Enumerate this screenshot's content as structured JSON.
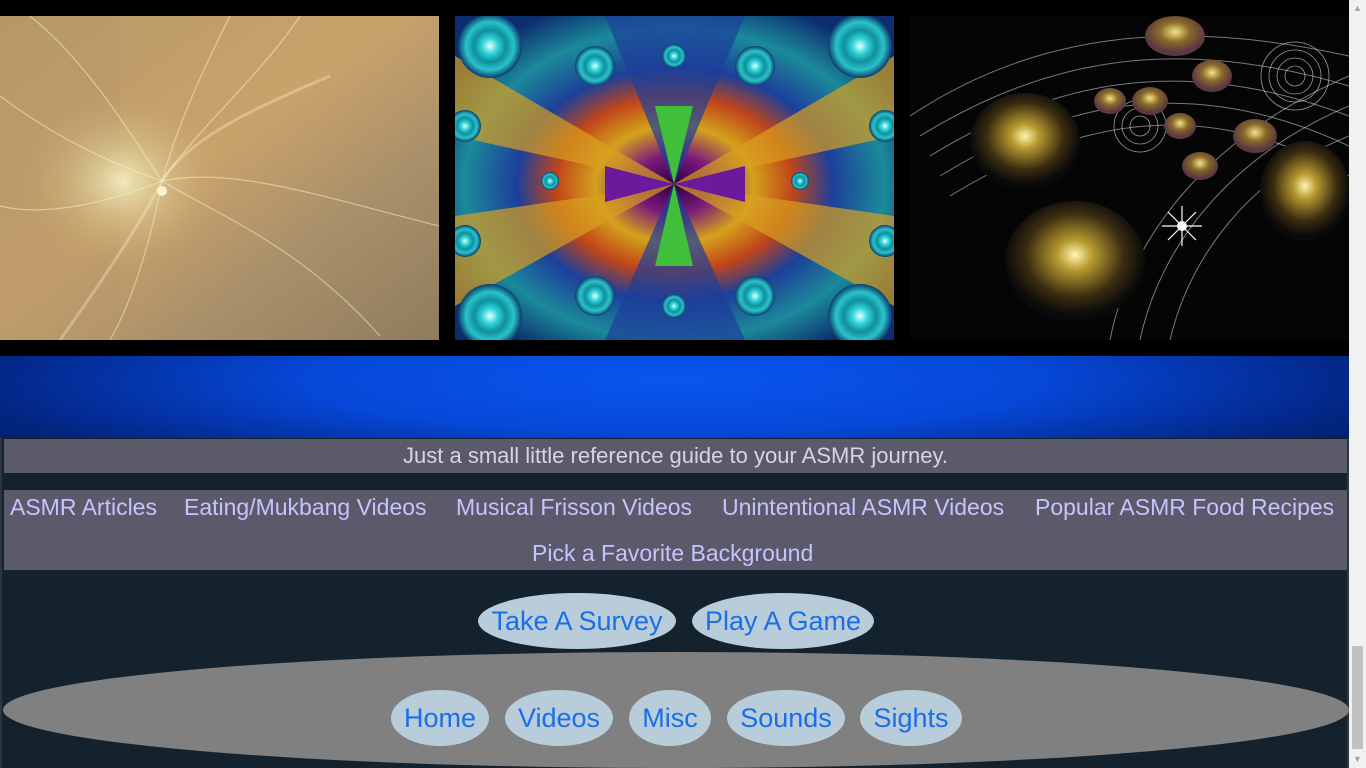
{
  "gallery": {
    "images": [
      {
        "name": "golden-fractal-image"
      },
      {
        "name": "psychedelic-fractal-image"
      },
      {
        "name": "spiral-orbs-fractal-image"
      }
    ]
  },
  "footer": {
    "tagline": "Just a small little reference guide to your ASMR journey.",
    "links": [
      "ASMR Articles",
      "Eating/Mukbang Videos",
      "Musical Frisson Videos",
      "Unintentional ASMR Videos",
      "Popular ASMR Food Recipes",
      "Pick a Favorite Background"
    ],
    "actions": {
      "survey": "Take A Survey",
      "game": "Play A Game"
    },
    "nav": {
      "home": "Home",
      "videos": "Videos",
      "misc": "Misc",
      "sounds": "Sounds",
      "sights": "Sights"
    }
  },
  "colors": {
    "pill_bg": "#b8cdd9",
    "pill_text": "#1a6fe8",
    "link_text": "#c8c2ff",
    "band_blue": "#0648d8",
    "footer_bg": "#14222e",
    "bar_bg": "#5b5a6b"
  },
  "scrollbar": {
    "up_icon": "arrow-up-icon",
    "down_icon": "arrow-down-icon"
  }
}
